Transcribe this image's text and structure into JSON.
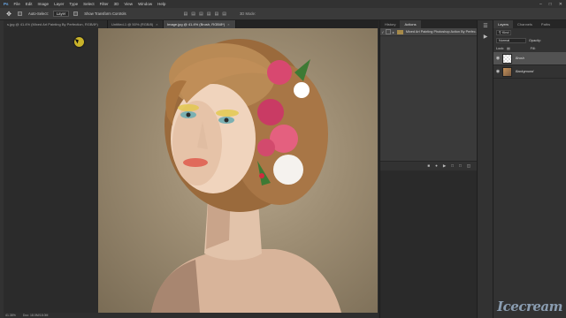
{
  "menubar": {
    "app_icon": "Ps",
    "items": [
      "File",
      "Edit",
      "Image",
      "Layer",
      "Type",
      "Select",
      "Filter",
      "3D",
      "View",
      "Window",
      "Help"
    ]
  },
  "options_bar": {
    "tool_icon": "move-tool-icon",
    "auto_select_label": "Auto-Select:",
    "auto_select_value": "Layer",
    "transform_label": "Show Transform Controls",
    "mode_3d_label": "3D Mode:"
  },
  "doc_tabs": [
    "s.jpg @ 41.4% (Mixed Art Painting By Perfection, RGB/8*)",
    "Untitled-1 @ 50% (RGB/8)",
    "Image.jpg @ 41.4% (Brush, RGB/8*)"
  ],
  "status": {
    "zoom": "41.38%",
    "doc": "Doc: 18.0M/18.0M"
  },
  "actions_panel": {
    "tabs": [
      "History",
      "Actions"
    ],
    "active_tab": "Actions",
    "action_set": "Mixed Art Painting Photoshop Action By Perfec..."
  },
  "layers_panel": {
    "tabs": [
      "Layers",
      "Channels",
      "Paths"
    ],
    "kind_label": "Kind",
    "blend_mode": "Normal",
    "opacity_label": "Opacity:",
    "lock_label": "Lock:",
    "fill_label": "Fill:",
    "layers": [
      {
        "name": "Brush",
        "selected": true,
        "thumb": "transparent"
      },
      {
        "name": "Background",
        "selected": false,
        "thumb": "image"
      }
    ]
  },
  "watermark": "Icecream"
}
